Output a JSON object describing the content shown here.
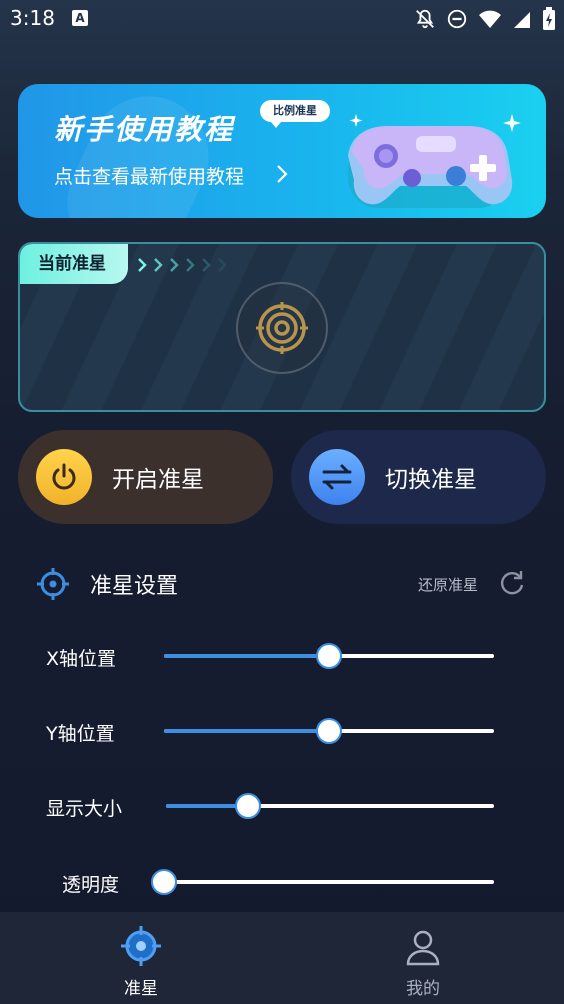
{
  "status_bar": {
    "time": "3:18",
    "notification_icon_text": "A",
    "icons": [
      "notifications-off-icon",
      "do-not-disturb-icon",
      "wifi-icon",
      "signal-icon",
      "battery-charging-icon"
    ]
  },
  "banner": {
    "title": "新手使用教程",
    "bubble": "比例准星",
    "subtitle": "点击查看最新使用教程",
    "chevron_icon": "chevron-right-icon",
    "image_icon": "gamepad-icon"
  },
  "current_crosshair": {
    "tag": "当前准星",
    "arrows_icon": "chevrons-right-icon",
    "preview_icon": "crosshair-target-icon"
  },
  "actions": {
    "enable": {
      "label": "开启准星",
      "icon": "power-icon",
      "color": "#f2b22a"
    },
    "switch": {
      "label": "切换准星",
      "icon": "swap-icon",
      "color": "#3f82f0"
    }
  },
  "settings": {
    "title": "准星设置",
    "icon": "crosshair-icon",
    "reset_label": "还原准星",
    "reset_icon": "refresh-icon",
    "sliders": [
      {
        "label": "X轴位置",
        "value": 0.5
      },
      {
        "label": "Y轴位置",
        "value": 0.5
      },
      {
        "label": "显示大小",
        "value": 0.25
      },
      {
        "label": "透明度",
        "value": 0.0
      }
    ]
  },
  "bottom_nav": {
    "items": [
      {
        "label": "准星",
        "icon": "crosshair-nav-icon",
        "active": true
      },
      {
        "label": "我的",
        "icon": "profile-icon",
        "active": false
      }
    ]
  },
  "colors": {
    "accent": "#3d8de0",
    "teal": "#6df0e0",
    "background": "#161d31"
  }
}
